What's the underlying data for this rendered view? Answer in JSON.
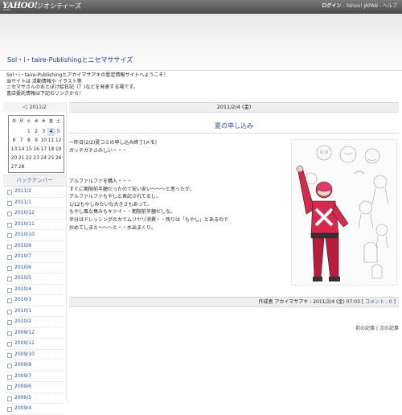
{
  "topbar": {
    "logo": "YAHOO!",
    "logo_sub": "JAPAN",
    "service": "ジオシティーズ",
    "login": "ログイン",
    "links": [
      "Yahoo! JAPAN",
      "ヘルプ"
    ],
    "separator": " - "
  },
  "header": {
    "blog_title": "Sol・i・taire-Publishingとニセマササイズ"
  },
  "intro": {
    "lines": [
      "Sol・i・taire-Publishingとアカイマサアキの暫定情報サイトへようこそ！",
      "当サイトは 活動情報や イラスト等",
      "ニセマサさんのおとぼけ絵日記（？)などを発表する場です。",
      "書店委託情報は下記のリンクから！"
    ]
  },
  "calendar": {
    "prev_arrow": "◁",
    "month": "2011/2",
    "days_of_week": [
      "日",
      "月",
      "火",
      "水",
      "木",
      "金",
      "土"
    ],
    "weeks": [
      [
        "",
        "",
        "1",
        "2",
        "3",
        "4",
        "5"
      ],
      [
        "6",
        "7",
        "8",
        "9",
        "10",
        "11",
        "12"
      ],
      [
        "13",
        "14",
        "15",
        "16",
        "17",
        "18",
        "19"
      ],
      [
        "20",
        "21",
        "22",
        "23",
        "24",
        "25",
        "26"
      ],
      [
        "27",
        "28",
        "",
        "",
        "",
        "",
        ""
      ]
    ],
    "today": "4"
  },
  "sidebar": {
    "backnumber_title": "バックナンバー",
    "archives": [
      "2011/2",
      "2011/1",
      "2010/12",
      "2010/11",
      "2010/10",
      "2010/8",
      "2010/7",
      "2010/6",
      "2010/5",
      "2010/4",
      "2010/3",
      "2010/1",
      "2010/2",
      "2009/12",
      "2009/11",
      "2009/10",
      "2009/8",
      "2009/7",
      "2009/6",
      "2009/5",
      "2009/4"
    ]
  },
  "post": {
    "date": "2011/2/4 (金)",
    "title": "夏の申し込み",
    "body_lines": [
      "一昨日(2/2)夏コミの申し込み終了(メモ)",
      "ガッチガチさみしい・・・",
      "",
      "",
      "",
      "アルファルファを購入・・・",
      "すぐに期限前半額だったので安い安い～～～と思ったが、",
      "アルファルファもやしと表記されてるし、",
      "1/12もやしみたいな大きさもあって、",
      "もやし風な臭みもキツイ・・期限前半額だしな。",
      "半分はドレッシングのカでムリヤリ消費・・残りは「もやし」とあるので",
      "炒めてしまえ～～～と・・水出まくり。"
    ],
    "footer_author_prefix": "作成者 アカイマサアキ : 2011/2/4 (金) 07:03 [ ",
    "footer_comment": "コメント : 0",
    "footer_suffix": " ]"
  },
  "nav": {
    "prev": "前の記事",
    "separator": " | ",
    "next": "次の記事"
  },
  "colors": {
    "link": "#2a55a7",
    "title": "#3150a0",
    "character_red": "#c4283a",
    "character_pink": "#e03a6a"
  }
}
